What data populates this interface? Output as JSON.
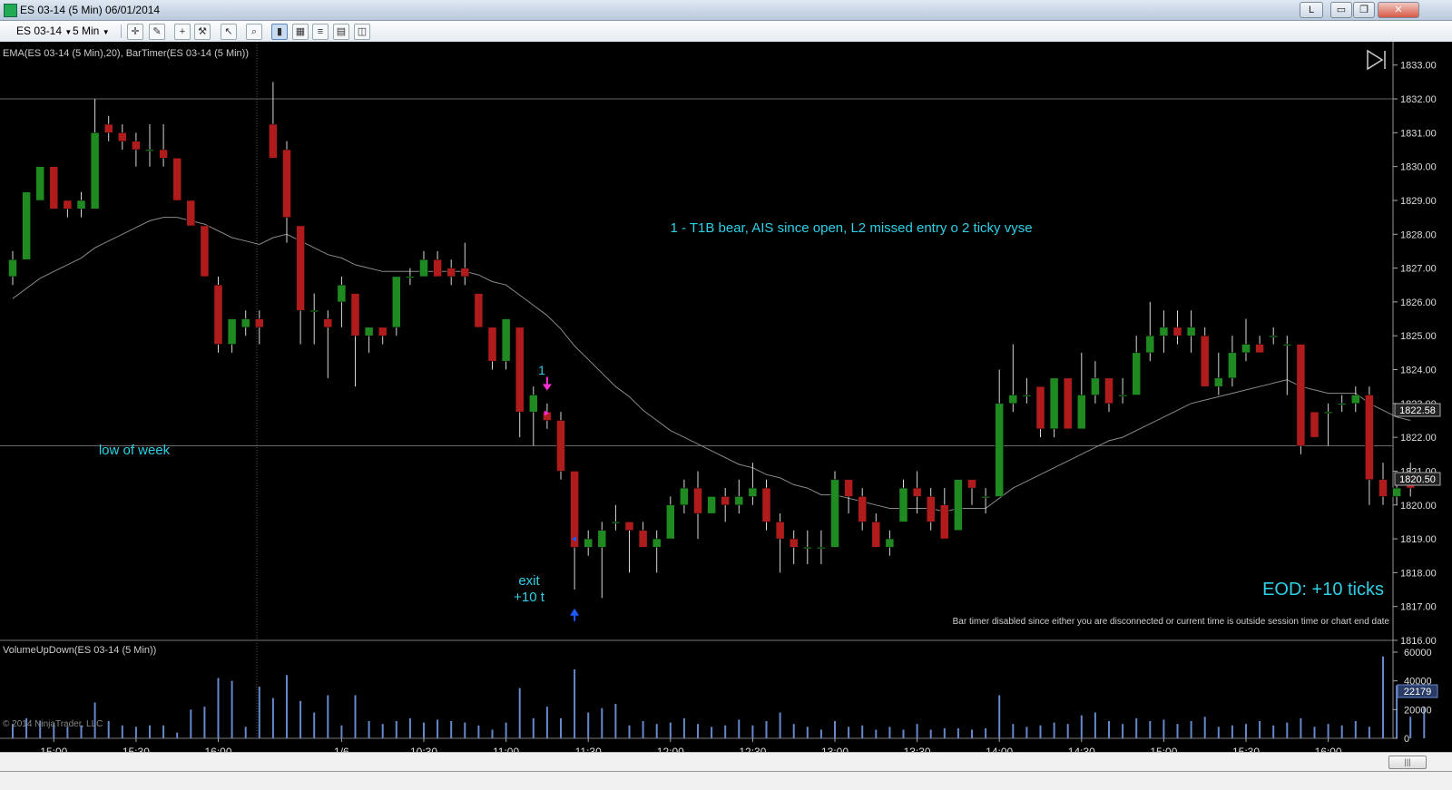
{
  "window": {
    "title": "ES 03-14 (5 Min)  06/01/2014",
    "buttons": {
      "l_label": "L",
      "minimize": "▭",
      "restore": "❐",
      "close": "✕"
    }
  },
  "toolbar": {
    "instrument": "ES 03-14",
    "interval": "5 Min",
    "icons": [
      "pencil-icon",
      "plus-icon",
      "wrench-icon",
      "pointer-icon",
      "zoom-icon",
      "bars-icon",
      "chart-icon",
      "properties-icon",
      "panel-icon"
    ]
  },
  "indicators": {
    "price_label": "EMA(ES 03-14 (5 Min),20), BarTimer(ES 03-14 (5 Min))",
    "volume_label": "VolumeUpDown(ES 03-14 (5 Min))",
    "copyright": "© 2014 NinjaTrader, LLC"
  },
  "annotations": {
    "setup_note": "1 - T1B bear, AIS since open, L2 missed entry o 2 ticky vyse",
    "low_of_week": "low of week",
    "entry_label": "1",
    "exit_line1": "exit",
    "exit_line2": "+10 t",
    "eod": "EOD: +10 ticks",
    "bar_timer_msg": "Bar timer disabled since either you are disconnected or current time is outside session time or chart end date"
  },
  "price_tags": {
    "ema": "1822.58",
    "last": "1820.50",
    "volume": "22179"
  },
  "colors": {
    "up": "#1f8a1f",
    "down": "#b01c1c",
    "wick": "#d8d8d8",
    "ema": "#8a8a8a",
    "text_cyan": "#2ed0e6",
    "volume": "#6688cc",
    "grid": "#666666"
  },
  "scroll": {
    "thumb_label": "|||"
  },
  "chart_data": {
    "type": "candlestick",
    "symbol": "ES 03-14",
    "interval": "5 Min",
    "price_axis": {
      "ticks": [
        "1833.00",
        "1832.00",
        "1831.00",
        "1830.00",
        "1829.00",
        "1828.00",
        "1827.00",
        "1826.00",
        "1825.00",
        "1824.00",
        "1823.00",
        "1822.00",
        "1821.00",
        "1820.00",
        "1819.00",
        "1818.00",
        "1817.00",
        "1816.00"
      ],
      "range": [
        1816,
        1833.1
      ]
    },
    "volume_axis": {
      "ticks": [
        "60000",
        "40000",
        "20000",
        "0"
      ],
      "range": [
        0,
        60000
      ]
    },
    "time_axis": {
      "ticks": [
        "15:00",
        "15:30",
        "16:00",
        "1/6",
        "10:30",
        "11:00",
        "11:30",
        "12:00",
        "12:30",
        "13:00",
        "13:30",
        "14:00",
        "14:30",
        "15:00",
        "15:30",
        "16:00"
      ]
    },
    "horizontal_lines": [
      1832.0,
      1821.75
    ],
    "candles_ohlc": [
      [
        1826.75,
        1827.25,
        1826.5,
        1827.5
      ],
      [
        1827.25,
        1829.25,
        1827.25,
        1829.25
      ],
      [
        1829.0,
        1830.0,
        1829.0,
        1830.0
      ],
      [
        1830.0,
        1828.75,
        1828.75,
        1830.0
      ],
      [
        1829.0,
        1828.75,
        1828.5,
        1829.0
      ],
      [
        1828.75,
        1829.0,
        1828.5,
        1829.25
      ],
      [
        1828.75,
        1831.0,
        1828.75,
        1832.0
      ],
      [
        1831.25,
        1831.0,
        1830.75,
        1831.5
      ],
      [
        1831.0,
        1830.75,
        1830.5,
        1831.25
      ],
      [
        1830.75,
        1830.5,
        1830.0,
        1831.0
      ],
      [
        1830.5,
        1830.5,
        1830.0,
        1831.25
      ],
      [
        1830.5,
        1830.25,
        1830.0,
        1831.25
      ],
      [
        1830.25,
        1829.0,
        1829.0,
        1830.25
      ],
      [
        1829.0,
        1828.25,
        1828.25,
        1829.0
      ],
      [
        1828.25,
        1826.75,
        1826.75,
        1828.25
      ],
      [
        1826.5,
        1824.75,
        1824.5,
        1826.75
      ],
      [
        1824.75,
        1825.5,
        1824.5,
        1825.5
      ],
      [
        1825.25,
        1825.5,
        1825.0,
        1825.75
      ],
      [
        1825.5,
        1825.25,
        1824.75,
        1825.75
      ],
      [
        1831.25,
        1830.25,
        1830.25,
        1832.5
      ],
      [
        1830.5,
        1828.5,
        1827.75,
        1830.75
      ],
      [
        1828.25,
        1825.75,
        1824.75,
        1828.25
      ],
      [
        1825.75,
        1825.75,
        1824.75,
        1826.25
      ],
      [
        1825.5,
        1825.25,
        1823.75,
        1825.75
      ],
      [
        1826.0,
        1826.5,
        1825.25,
        1826.75
      ],
      [
        1826.25,
        1825.0,
        1823.5,
        1826.25
      ],
      [
        1825.0,
        1825.25,
        1824.5,
        1825.25
      ],
      [
        1825.25,
        1825.0,
        1824.75,
        1825.25
      ],
      [
        1825.25,
        1826.75,
        1825.0,
        1826.75
      ],
      [
        1826.75,
        1826.75,
        1826.5,
        1827.0
      ],
      [
        1826.75,
        1827.25,
        1826.75,
        1827.5
      ],
      [
        1827.25,
        1826.75,
        1826.75,
        1827.5
      ],
      [
        1827.0,
        1826.75,
        1826.5,
        1827.25
      ],
      [
        1827.0,
        1826.75,
        1826.5,
        1827.75
      ],
      [
        1826.25,
        1825.25,
        1825.25,
        1826.25
      ],
      [
        1825.25,
        1824.25,
        1824.0,
        1825.25
      ],
      [
        1824.25,
        1825.5,
        1824.0,
        1825.5
      ],
      [
        1825.25,
        1822.75,
        1822.0,
        1825.25
      ],
      [
        1822.75,
        1823.25,
        1821.75,
        1823.5
      ],
      [
        1822.75,
        1822.5,
        1822.25,
        1823.0
      ],
      [
        1822.5,
        1821.0,
        1820.75,
        1822.75
      ],
      [
        1821.0,
        1818.75,
        1817.5,
        1821.0
      ],
      [
        1818.75,
        1819.0,
        1818.5,
        1819.25
      ],
      [
        1818.75,
        1819.25,
        1817.25,
        1819.5
      ],
      [
        1819.5,
        1819.5,
        1819.25,
        1820.0
      ],
      [
        1819.5,
        1819.25,
        1818.0,
        1819.5
      ],
      [
        1819.25,
        1818.75,
        1818.75,
        1819.5
      ],
      [
        1818.75,
        1819.0,
        1818.0,
        1819.25
      ],
      [
        1819.0,
        1820.0,
        1819.0,
        1820.25
      ],
      [
        1820.0,
        1820.5,
        1819.75,
        1820.75
      ],
      [
        1820.5,
        1819.75,
        1819.0,
        1821.0
      ],
      [
        1819.75,
        1820.25,
        1819.75,
        1820.25
      ],
      [
        1820.25,
        1820.0,
        1819.5,
        1820.5
      ],
      [
        1820.0,
        1820.25,
        1819.75,
        1820.75
      ],
      [
        1820.25,
        1820.5,
        1820.0,
        1821.25
      ],
      [
        1820.5,
        1819.5,
        1819.25,
        1820.75
      ],
      [
        1819.5,
        1819.0,
        1818.0,
        1819.75
      ],
      [
        1819.0,
        1818.75,
        1818.25,
        1819.25
      ],
      [
        1818.75,
        1818.75,
        1818.25,
        1819.25
      ],
      [
        1818.75,
        1818.75,
        1818.25,
        1819.25
      ],
      [
        1818.75,
        1820.75,
        1818.75,
        1821.0
      ],
      [
        1820.75,
        1820.25,
        1819.75,
        1820.75
      ],
      [
        1820.25,
        1819.5,
        1819.25,
        1820.5
      ],
      [
        1819.5,
        1818.75,
        1818.75,
        1819.75
      ],
      [
        1818.75,
        1819.0,
        1818.5,
        1819.25
      ],
      [
        1819.5,
        1820.5,
        1819.5,
        1820.75
      ],
      [
        1820.5,
        1820.25,
        1819.75,
        1821.0
      ],
      [
        1820.25,
        1819.5,
        1819.25,
        1820.5
      ],
      [
        1820.0,
        1819.0,
        1819.0,
        1820.5
      ],
      [
        1819.25,
        1820.75,
        1819.25,
        1820.75
      ],
      [
        1820.75,
        1820.5,
        1820.0,
        1820.75
      ],
      [
        1820.25,
        1820.25,
        1819.75,
        1820.5
      ],
      [
        1820.25,
        1823.0,
        1820.25,
        1824.0
      ],
      [
        1823.0,
        1823.25,
        1822.75,
        1824.75
      ],
      [
        1823.25,
        1823.25,
        1823.0,
        1823.75
      ],
      [
        1823.5,
        1822.25,
        1822.0,
        1823.5
      ],
      [
        1822.25,
        1823.75,
        1822.0,
        1823.75
      ],
      [
        1823.75,
        1822.25,
        1822.25,
        1823.75
      ],
      [
        1822.25,
        1823.25,
        1822.25,
        1824.5
      ],
      [
        1823.25,
        1823.75,
        1823.0,
        1824.25
      ],
      [
        1823.75,
        1823.0,
        1822.75,
        1823.75
      ],
      [
        1823.25,
        1823.25,
        1823.0,
        1823.75
      ],
      [
        1823.25,
        1824.5,
        1823.25,
        1825.0
      ],
      [
        1824.5,
        1825.0,
        1824.25,
        1826.0
      ],
      [
        1825.0,
        1825.25,
        1824.5,
        1825.75
      ],
      [
        1825.25,
        1825.0,
        1824.75,
        1825.75
      ],
      [
        1825.0,
        1825.25,
        1824.5,
        1825.75
      ],
      [
        1825.0,
        1823.5,
        1823.5,
        1825.25
      ],
      [
        1823.5,
        1823.75,
        1823.25,
        1824.5
      ],
      [
        1823.75,
        1824.5,
        1823.5,
        1825.0
      ],
      [
        1824.5,
        1824.75,
        1824.25,
        1825.5
      ],
      [
        1824.75,
        1824.5,
        1824.5,
        1825.0
      ],
      [
        1825.0,
        1825.0,
        1824.75,
        1825.25
      ],
      [
        1824.75,
        1824.75,
        1823.25,
        1825.0
      ],
      [
        1824.75,
        1821.75,
        1821.5,
        1824.75
      ],
      [
        1822.75,
        1822.0,
        1822.0,
        1822.75
      ],
      [
        1822.75,
        1822.75,
        1821.75,
        1823.0
      ],
      [
        1823.0,
        1823.0,
        1822.75,
        1823.25
      ],
      [
        1823.0,
        1823.25,
        1822.75,
        1823.5
      ],
      [
        1823.25,
        1820.75,
        1820.0,
        1823.5
      ],
      [
        1820.75,
        1820.25,
        1820.0,
        1821.25
      ],
      [
        1820.25,
        1820.5,
        1820.0,
        1820.75
      ],
      [
        1820.75,
        1820.5,
        1820.25,
        1821.25
      ]
    ],
    "ema_20": [
      1826.1,
      1826.4,
      1826.7,
      1826.9,
      1827.1,
      1827.3,
      1827.6,
      1827.8,
      1828.0,
      1828.2,
      1828.4,
      1828.5,
      1828.5,
      1828.4,
      1828.3,
      1828.1,
      1827.9,
      1827.8,
      1827.7,
      1827.9,
      1828.0,
      1827.8,
      1827.6,
      1827.4,
      1827.3,
      1827.1,
      1827.0,
      1826.9,
      1826.9,
      1826.9,
      1826.9,
      1826.9,
      1826.9,
      1826.9,
      1826.8,
      1826.6,
      1826.5,
      1826.2,
      1825.9,
      1825.6,
      1825.2,
      1824.7,
      1824.3,
      1823.9,
      1823.5,
      1823.2,
      1822.8,
      1822.5,
      1822.2,
      1822.0,
      1821.8,
      1821.6,
      1821.4,
      1821.2,
      1821.1,
      1820.9,
      1820.8,
      1820.6,
      1820.5,
      1820.3,
      1820.3,
      1820.2,
      1820.1,
      1820.0,
      1819.9,
      1819.9,
      1819.9,
      1819.9,
      1819.8,
      1819.9,
      1819.9,
      1819.9,
      1820.2,
      1820.5,
      1820.7,
      1820.9,
      1821.1,
      1821.3,
      1821.5,
      1821.7,
      1821.9,
      1822.0,
      1822.2,
      1822.4,
      1822.6,
      1822.8,
      1823.0,
      1823.1,
      1823.2,
      1823.3,
      1823.4,
      1823.5,
      1823.6,
      1823.7,
      1823.5,
      1823.4,
      1823.3,
      1823.3,
      1823.3,
      1823.0,
      1822.8,
      1822.6,
      1822.5
    ],
    "volume": [
      10000,
      14000,
      12000,
      10000,
      8000,
      9000,
      25000,
      12000,
      9000,
      8000,
      9000,
      9000,
      4000,
      20000,
      22000,
      42000,
      40000,
      8000,
      36000,
      28000,
      44000,
      26000,
      18000,
      30000,
      9000,
      30000,
      12000,
      10000,
      12000,
      14000,
      11000,
      13000,
      12000,
      11000,
      9000,
      6000,
      11000,
      35000,
      14000,
      22000,
      14000,
      48000,
      18000,
      21000,
      24000,
      9000,
      12000,
      10000,
      11000,
      14000,
      10000,
      8000,
      9000,
      13000,
      9000,
      12000,
      18000,
      10000,
      8000,
      6000,
      12000,
      8000,
      9000,
      6000,
      8000,
      6000,
      10000,
      6000,
      7000,
      7000,
      6000,
      7000,
      30000,
      10000,
      8000,
      9000,
      11000,
      10000,
      16000,
      18000,
      12000,
      10000,
      14000,
      12000,
      13000,
      10000,
      12000,
      15000,
      8000,
      9000,
      10000,
      12000,
      9000,
      11000,
      14000,
      8000,
      10000,
      9000,
      12000,
      8000,
      57000,
      37000,
      15000,
      22000
    ],
    "markers": [
      {
        "type": "entry",
        "label": "1",
        "candle_index": 39,
        "price": 1823.25
      },
      {
        "type": "exit",
        "label": "exit +10 t",
        "candle_index": 41,
        "price": 1817.0
      }
    ]
  }
}
